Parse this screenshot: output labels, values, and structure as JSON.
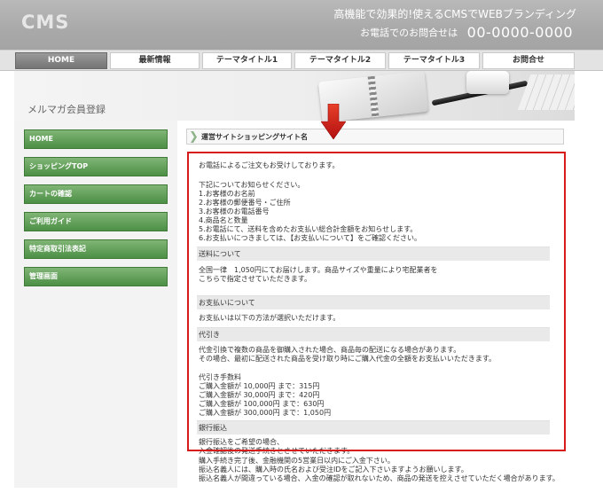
{
  "header": {
    "logo": "CMS",
    "tagline": "高機能で効果的!使えるCMSでWEBブランディング",
    "contact_label": "お電話でのお問合せは",
    "phone": "00-0000-0000"
  },
  "nav": {
    "items": [
      "HOME",
      "最新情報",
      "テーマタイトル1",
      "テーマタイトル2",
      "テーマタイトル3",
      "お問合せ"
    ],
    "active_index": 0
  },
  "hero": {
    "title": "メルマガ会員登録"
  },
  "sidebar": {
    "items": [
      "HOME",
      "ショッピングTOP",
      "カートの確認",
      "ご利用ガイド",
      "特定商取引法表記",
      "管理画面"
    ]
  },
  "main": {
    "heading": "運営サイトショッピングサイト名",
    "intro": "お電話によるご注文もお受けしております。",
    "notice_title": "下記についてお知らせください。",
    "notice_list": [
      "1.お客様のお名前",
      "2.お客様の郵便番号・ご住所",
      "3.お客様のお電話番号",
      "4.商品名と数量",
      "5.お電話にて、送料を含めたお支払い総合計金額をお知らせします。",
      "6.お支払いにつきましては、【お支払いについて】をご確認ください。"
    ],
    "shipping": {
      "title": "送料について",
      "lines": [
        "全国一律　1,050円にてお届けします。商品サイズや重量により宅配業者を",
        "こちらで指定させていただきます。"
      ]
    },
    "payment": {
      "title": "お支払いについて",
      "text": "お支払いは以下の方法が選択いただけます。"
    },
    "cod": {
      "title": "代引き",
      "lines": [
        "代金引換で複数の商品を御購入された場合、商品毎の配送になる場合があります。",
        "その場合、最初に配送された商品を受け取り時にご購入代金の全額をお支払いいただきます。"
      ],
      "fee_title": "代引き手数料",
      "fees": [
        "ご購入金額が 10,000円 まで：315円",
        "ご購入金額が 30,000円 まで：420円",
        "ご購入金額が 100,000円 まで：630円",
        "ご購入金額が 300,000円 まで：1,050円"
      ]
    },
    "bank": {
      "title": "銀行振込",
      "lines": [
        "銀行振込をご希望の場合、",
        "入金確認後の発送手続きとさせていただきます。",
        "購入手続き完了後、金融機関の5営業日以内にご入金下さい。",
        "振込名義人には、購入時の氏名および受注IDをご記入下さいますようお願いします。",
        "振込名義人が間違っている場合、入金の確認が取れないため、商品の発送を控えさせていただく場合があります。"
      ]
    }
  },
  "colors": {
    "header_gray": "#a9a9a9",
    "side_green": "#4c8f45",
    "highlight_red": "#d71b1b"
  }
}
